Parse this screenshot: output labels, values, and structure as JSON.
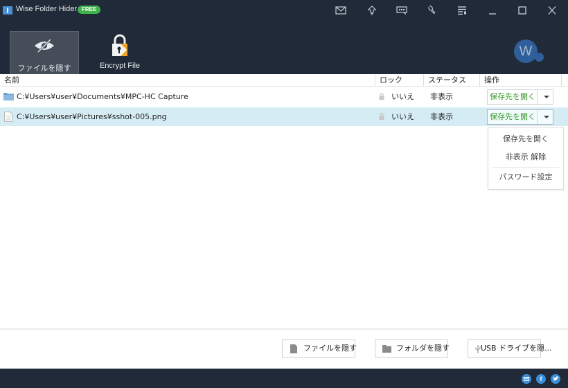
{
  "app": {
    "title": "Wise Folder Hider",
    "badge": "FREE"
  },
  "top_icons": [
    "mail-icon",
    "upgrade-icon",
    "feedback-icon",
    "settings-wrench-icon",
    "menu-icon",
    "minimize-icon",
    "maximize-icon",
    "close-icon"
  ],
  "nav": {
    "tabs": [
      {
        "label": "ファイルを隠す",
        "icon": "hidden-eye-icon",
        "active": true
      },
      {
        "label": "Encrypt File",
        "icon": "padlock-icon",
        "active": false
      }
    ]
  },
  "avatar": {
    "letter": "W"
  },
  "table": {
    "columns": [
      "名前",
      "ロック",
      "ステータス",
      "操作"
    ],
    "rows": [
      {
        "type": "folder",
        "name": "C:¥Users¥user¥Documents¥MPC-HC Capture",
        "lock": "いいえ",
        "status": "非表示",
        "action": "保存先を開く",
        "selected": false
      },
      {
        "type": "file",
        "name": "C:¥Users¥user¥Pictures¥sshot-005.png",
        "lock": "いいえ",
        "status": "非表示",
        "action": "保存先を開く",
        "selected": true
      }
    ]
  },
  "dropdown": {
    "items": [
      "保存先を開く",
      "非表示 解除",
      "パスワード設定"
    ]
  },
  "bottom_buttons": [
    {
      "label": "ファイルを隠す",
      "icon": "file-icon"
    },
    {
      "label": "フォルダを隠す",
      "icon": "folder-icon"
    },
    {
      "label": "USB ドライブを隠...",
      "icon": "usb-icon"
    }
  ],
  "footer": {
    "social": [
      "email-icon",
      "facebook-icon",
      "twitter-icon"
    ],
    "facebook_glyph": "f"
  },
  "colors": {
    "titlebar": "#212a38",
    "accent_green": "#3a9a2c",
    "selected_row": "#d5ecf4",
    "free_badge": "#3db34a",
    "avatar": "#2e5f9a"
  }
}
